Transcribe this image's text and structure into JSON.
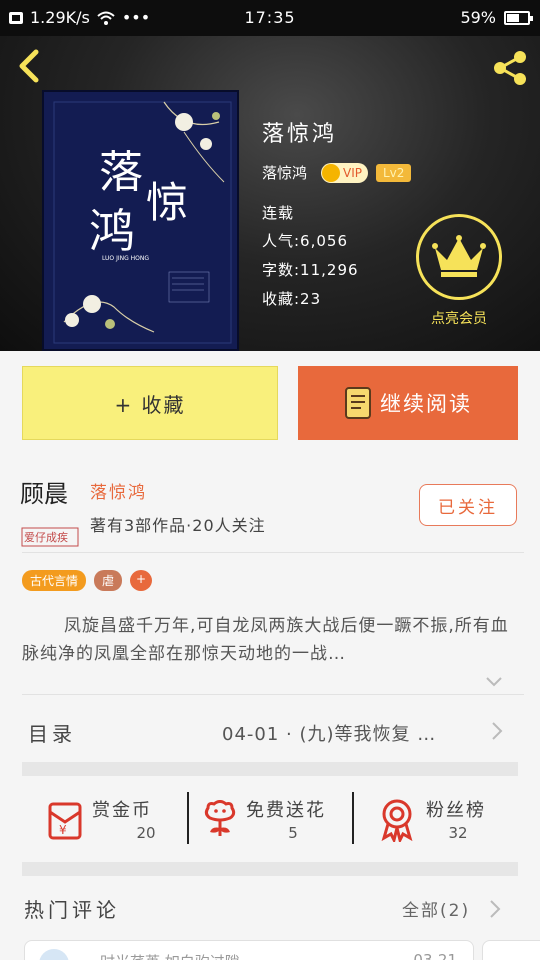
{
  "status": {
    "speed": "1.29K/s",
    "dots": "•••",
    "time": "17:35",
    "battery_text": "59%",
    "battery_level": 0.59
  },
  "book": {
    "title": "落惊鸿",
    "author": "落惊鸿",
    "vip_label": "VIP",
    "level_label": "Lv2",
    "serial_status": "连载",
    "popularity": "人气:6,056",
    "word_count": "字数:11,296",
    "favorites": "收藏:23",
    "member_label": "点亮会员",
    "cover_title_chars": [
      "落",
      "惊",
      "鸿"
    ],
    "cover_pinyin": "LUO JING HONG"
  },
  "actions": {
    "favorite_label": "+ 收藏",
    "continue_label": "继续阅读"
  },
  "author_section": {
    "avatar_script": "顾晨",
    "avatar_stamp": "爱仔成疾",
    "name": "落惊鸿",
    "desc": "著有3部作品·20人关注",
    "follow_label": "已关注"
  },
  "tags": [
    "古代言情",
    "虐",
    "+"
  ],
  "synopsis": "凤旋昌盛千万年,可自龙凤两族大战后便一蹶不振,所有血脉纯净的凤凰全部在那惊天动地的一战…",
  "toc": {
    "label": "目录",
    "latest": "04-01 · (九)等我恢复 …"
  },
  "stats": [
    {
      "title": "赏金币",
      "value": "20",
      "icon": "red-envelope-icon"
    },
    {
      "title": "免费送花",
      "value": "5",
      "icon": "flower-icon"
    },
    {
      "title": "粉丝榜",
      "value": "32",
      "icon": "medal-icon"
    }
  ],
  "comments": {
    "title": "热门评论",
    "all_label": "全部(2)",
    "preview_text": "…时光荏苒,如白驹过隙",
    "preview_date": "03-21"
  },
  "colors": {
    "accent": "#e8693c",
    "gold": "#f6e259",
    "favorite_bg": "#f9f07c"
  }
}
